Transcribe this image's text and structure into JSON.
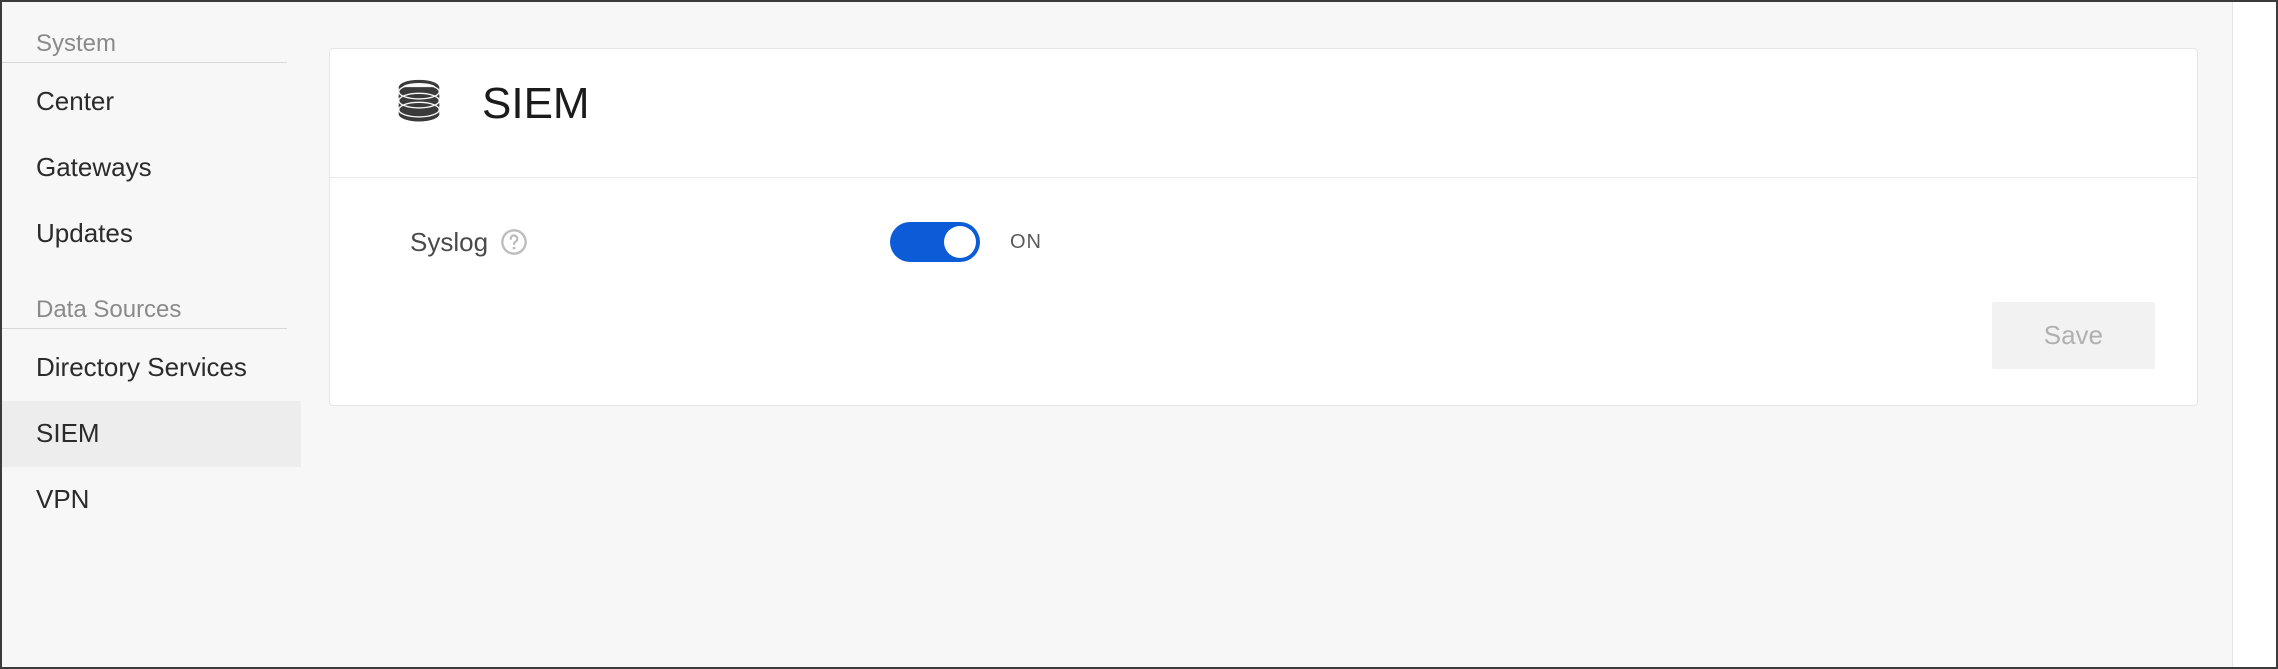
{
  "sidebar": {
    "sections": [
      {
        "title": "System",
        "items": [
          "Center",
          "Gateways",
          "Updates"
        ]
      },
      {
        "title": "Data Sources",
        "items": [
          "Directory Services",
          "SIEM",
          "VPN"
        ]
      }
    ],
    "active": "SIEM"
  },
  "panel": {
    "title": "SIEM",
    "setting": {
      "label": "Syslog",
      "toggle_state": "ON",
      "toggle_on": true
    },
    "save_label": "Save"
  }
}
